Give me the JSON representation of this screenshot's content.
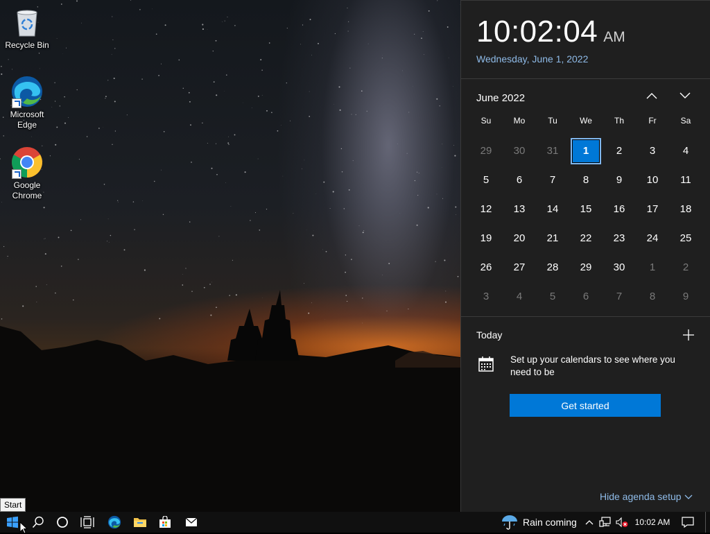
{
  "desktop": {
    "icons": [
      {
        "label": "Recycle Bin",
        "icon": "recycle-bin-icon"
      },
      {
        "label": "Microsoft\nEdge",
        "label_line1": "Microsoft",
        "label_line2": "Edge",
        "icon": "edge-icon"
      },
      {
        "label_line1": "Google",
        "label_line2": "Chrome",
        "icon": "chrome-icon"
      }
    ]
  },
  "clock": {
    "time": "10:02:04",
    "ampm": "AM",
    "date": "Wednesday, June 1, 2022"
  },
  "calendar": {
    "month_label": "June 2022",
    "weekdays": [
      "Su",
      "Mo",
      "Tu",
      "We",
      "Th",
      "Fr",
      "Sa"
    ],
    "weeks": [
      [
        {
          "d": "29",
          "other": true
        },
        {
          "d": "30",
          "other": true
        },
        {
          "d": "31",
          "other": true
        },
        {
          "d": "1",
          "today": true
        },
        {
          "d": "2"
        },
        {
          "d": "3"
        },
        {
          "d": "4"
        }
      ],
      [
        {
          "d": "5"
        },
        {
          "d": "6"
        },
        {
          "d": "7"
        },
        {
          "d": "8"
        },
        {
          "d": "9"
        },
        {
          "d": "10"
        },
        {
          "d": "11"
        }
      ],
      [
        {
          "d": "12"
        },
        {
          "d": "13"
        },
        {
          "d": "14"
        },
        {
          "d": "15"
        },
        {
          "d": "16"
        },
        {
          "d": "17"
        },
        {
          "d": "18"
        }
      ],
      [
        {
          "d": "19"
        },
        {
          "d": "20"
        },
        {
          "d": "21"
        },
        {
          "d": "22"
        },
        {
          "d": "23"
        },
        {
          "d": "24"
        },
        {
          "d": "25"
        }
      ],
      [
        {
          "d": "26"
        },
        {
          "d": "27"
        },
        {
          "d": "28"
        },
        {
          "d": "29"
        },
        {
          "d": "30"
        },
        {
          "d": "1",
          "other": true
        },
        {
          "d": "2",
          "other": true
        }
      ],
      [
        {
          "d": "3",
          "other": true
        },
        {
          "d": "4",
          "other": true
        },
        {
          "d": "5",
          "other": true
        },
        {
          "d": "6",
          "other": true
        },
        {
          "d": "7",
          "other": true
        },
        {
          "d": "8",
          "other": true
        },
        {
          "d": "9",
          "other": true
        }
      ]
    ]
  },
  "agenda": {
    "today_label": "Today",
    "setup_text": "Set up your calendars to see where you need to be",
    "get_started_label": "Get started",
    "hide_label": "Hide agenda setup"
  },
  "taskbar": {
    "start_tooltip": "Start",
    "weather_text": "Rain coming",
    "clock": "10:02 AM",
    "icons": [
      "windows-start-icon",
      "search-icon",
      "cortana-icon",
      "task-view-icon",
      "edge-icon",
      "file-explorer-icon",
      "store-icon",
      "mail-icon"
    ]
  },
  "colors": {
    "accent": "#0078d7",
    "flyout_bg": "#1f1f1f",
    "date_link": "#8fbbe8",
    "taskbar_bg": "#101010"
  }
}
